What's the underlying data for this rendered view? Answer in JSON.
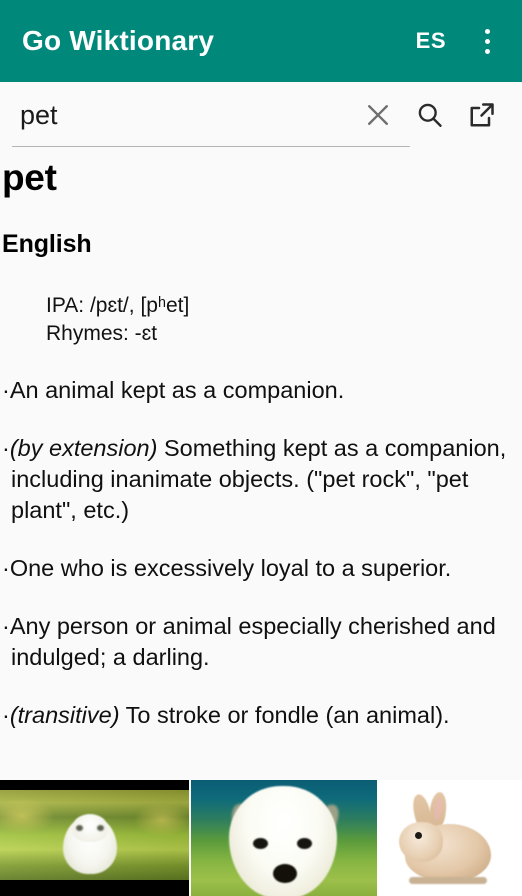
{
  "appbar": {
    "title": "Go Wiktionary",
    "language_button": "ES",
    "overflow_icon": "more-vert-icon",
    "background_color": "#00897B",
    "text_color": "#FFFFFF"
  },
  "search": {
    "value": "pet",
    "placeholder": "Search",
    "clear_icon": "close-icon",
    "search_icon": "search-icon",
    "open_external_icon": "open-in-new-icon"
  },
  "entry": {
    "headword": "pet",
    "section_heading": "English",
    "pronunciation": [
      "IPA: /pɛt/, [pʰet]",
      "Rhymes: -ɛt"
    ],
    "definitions": [
      {
        "bullet": "·",
        "pos": "",
        "text": "An animal kept as a companion."
      },
      {
        "bullet": "·",
        "pos": "(by extension)",
        "text": " Something kept as a companion, including inanimate objects. (\"pet rock\", \"pet plant\", etc.)"
      },
      {
        "bullet": "·",
        "pos": "",
        "text": "One who is excessively loyal to a superior."
      },
      {
        "bullet": "·",
        "pos": "",
        "text": "Any person or animal especially cherished and indulged; a darling."
      },
      {
        "bullet": "·",
        "pos": "(transitive)",
        "text": " To stroke or fondle (an animal)."
      }
    ]
  },
  "images": [
    {
      "alt": "white kitten sitting in green grass"
    },
    {
      "alt": "white puppy portrait on green background"
    },
    {
      "alt": "tan rabbit on white background"
    }
  ],
  "colors": {
    "accent": "#00897B",
    "page_background": "#FAFAFA",
    "text": "#111111",
    "icon_muted": "#6E6E6E",
    "icon_dark": "#2B2B2B",
    "divider": "#B5B5B5"
  }
}
